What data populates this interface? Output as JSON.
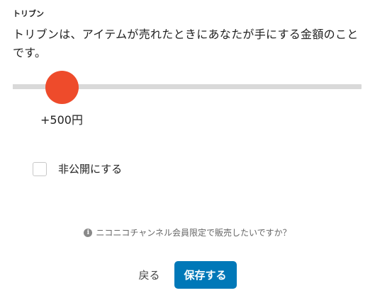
{
  "price": {
    "section_label": "トリブン",
    "description": "トリブンは、アイテムが売れたときにあなたが手にする金額のことです。",
    "slider": {
      "value_fraction": 0.14
    },
    "value_text": "+500円"
  },
  "private_option": {
    "label": "非公開にする",
    "checked": false
  },
  "notice": {
    "icon": "info-icon",
    "text": "ニコニコチャンネル会員限定で販売したいですか？"
  },
  "actions": {
    "back_label": "戻る",
    "save_label": "保存する"
  },
  "colors": {
    "slider_thumb": "#ee4b2b",
    "slider_track": "#d9d9d9",
    "save_button": "#0078b8"
  }
}
